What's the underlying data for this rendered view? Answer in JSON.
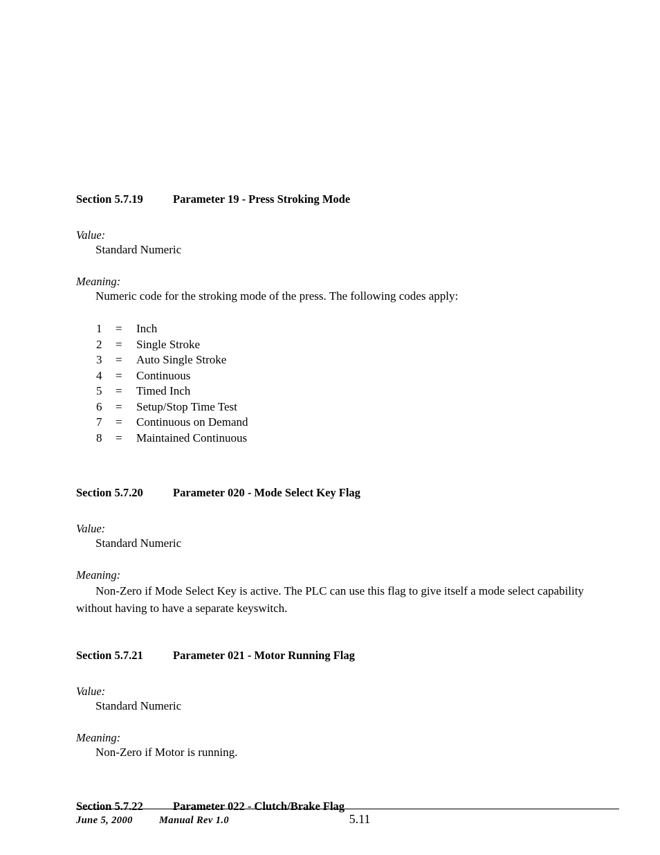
{
  "document": {
    "sections": [
      {
        "number": "Section 5.7.19",
        "title": "Parameter 19 - Press Stroking Mode",
        "value_label": "Value:",
        "value_text": "Standard Numeric",
        "meaning_label": "Meaning:",
        "meaning_text": "Numeric code for the stroking mode of the press.  The following codes apply:",
        "codes": [
          {
            "num": "1",
            "eq": "=",
            "label": "Inch"
          },
          {
            "num": "2",
            "eq": "=",
            "label": "Single Stroke"
          },
          {
            "num": "3",
            "eq": "=",
            "label": "Auto Single Stroke"
          },
          {
            "num": "4",
            "eq": "=",
            "label": "Continuous"
          },
          {
            "num": "5",
            "eq": "=",
            "label": "Timed Inch"
          },
          {
            "num": "6",
            "eq": "=",
            "label": "Setup/Stop Time Test"
          },
          {
            "num": "7",
            "eq": "=",
            "label": "Continuous on Demand"
          },
          {
            "num": "8",
            "eq": "=",
            "label": "Maintained Continuous"
          }
        ]
      },
      {
        "number": "Section 5.7.20",
        "title": "Parameter 020 - Mode Select Key Flag",
        "value_label": "Value:",
        "value_text": "Standard Numeric",
        "meaning_label": "Meaning:",
        "meaning_text": "Non-Zero if Mode Select Key is active.  The PLC can use this flag to give itself a mode select capability without having to have a separate keyswitch."
      },
      {
        "number": "Section 5.7.21",
        "title": "Parameter 021 - Motor Running Flag",
        "value_label": "Value:",
        "value_text": "Standard Numeric",
        "meaning_label": "Meaning:",
        "meaning_text": "Non-Zero if Motor is running."
      },
      {
        "number": "Section 5.7.22",
        "title": "Parameter 022 - Clutch/Brake Flag"
      }
    ]
  },
  "footer": {
    "date": "June 5, 2000",
    "revision": "Manual Rev 1.0",
    "page_number": "5.11"
  }
}
